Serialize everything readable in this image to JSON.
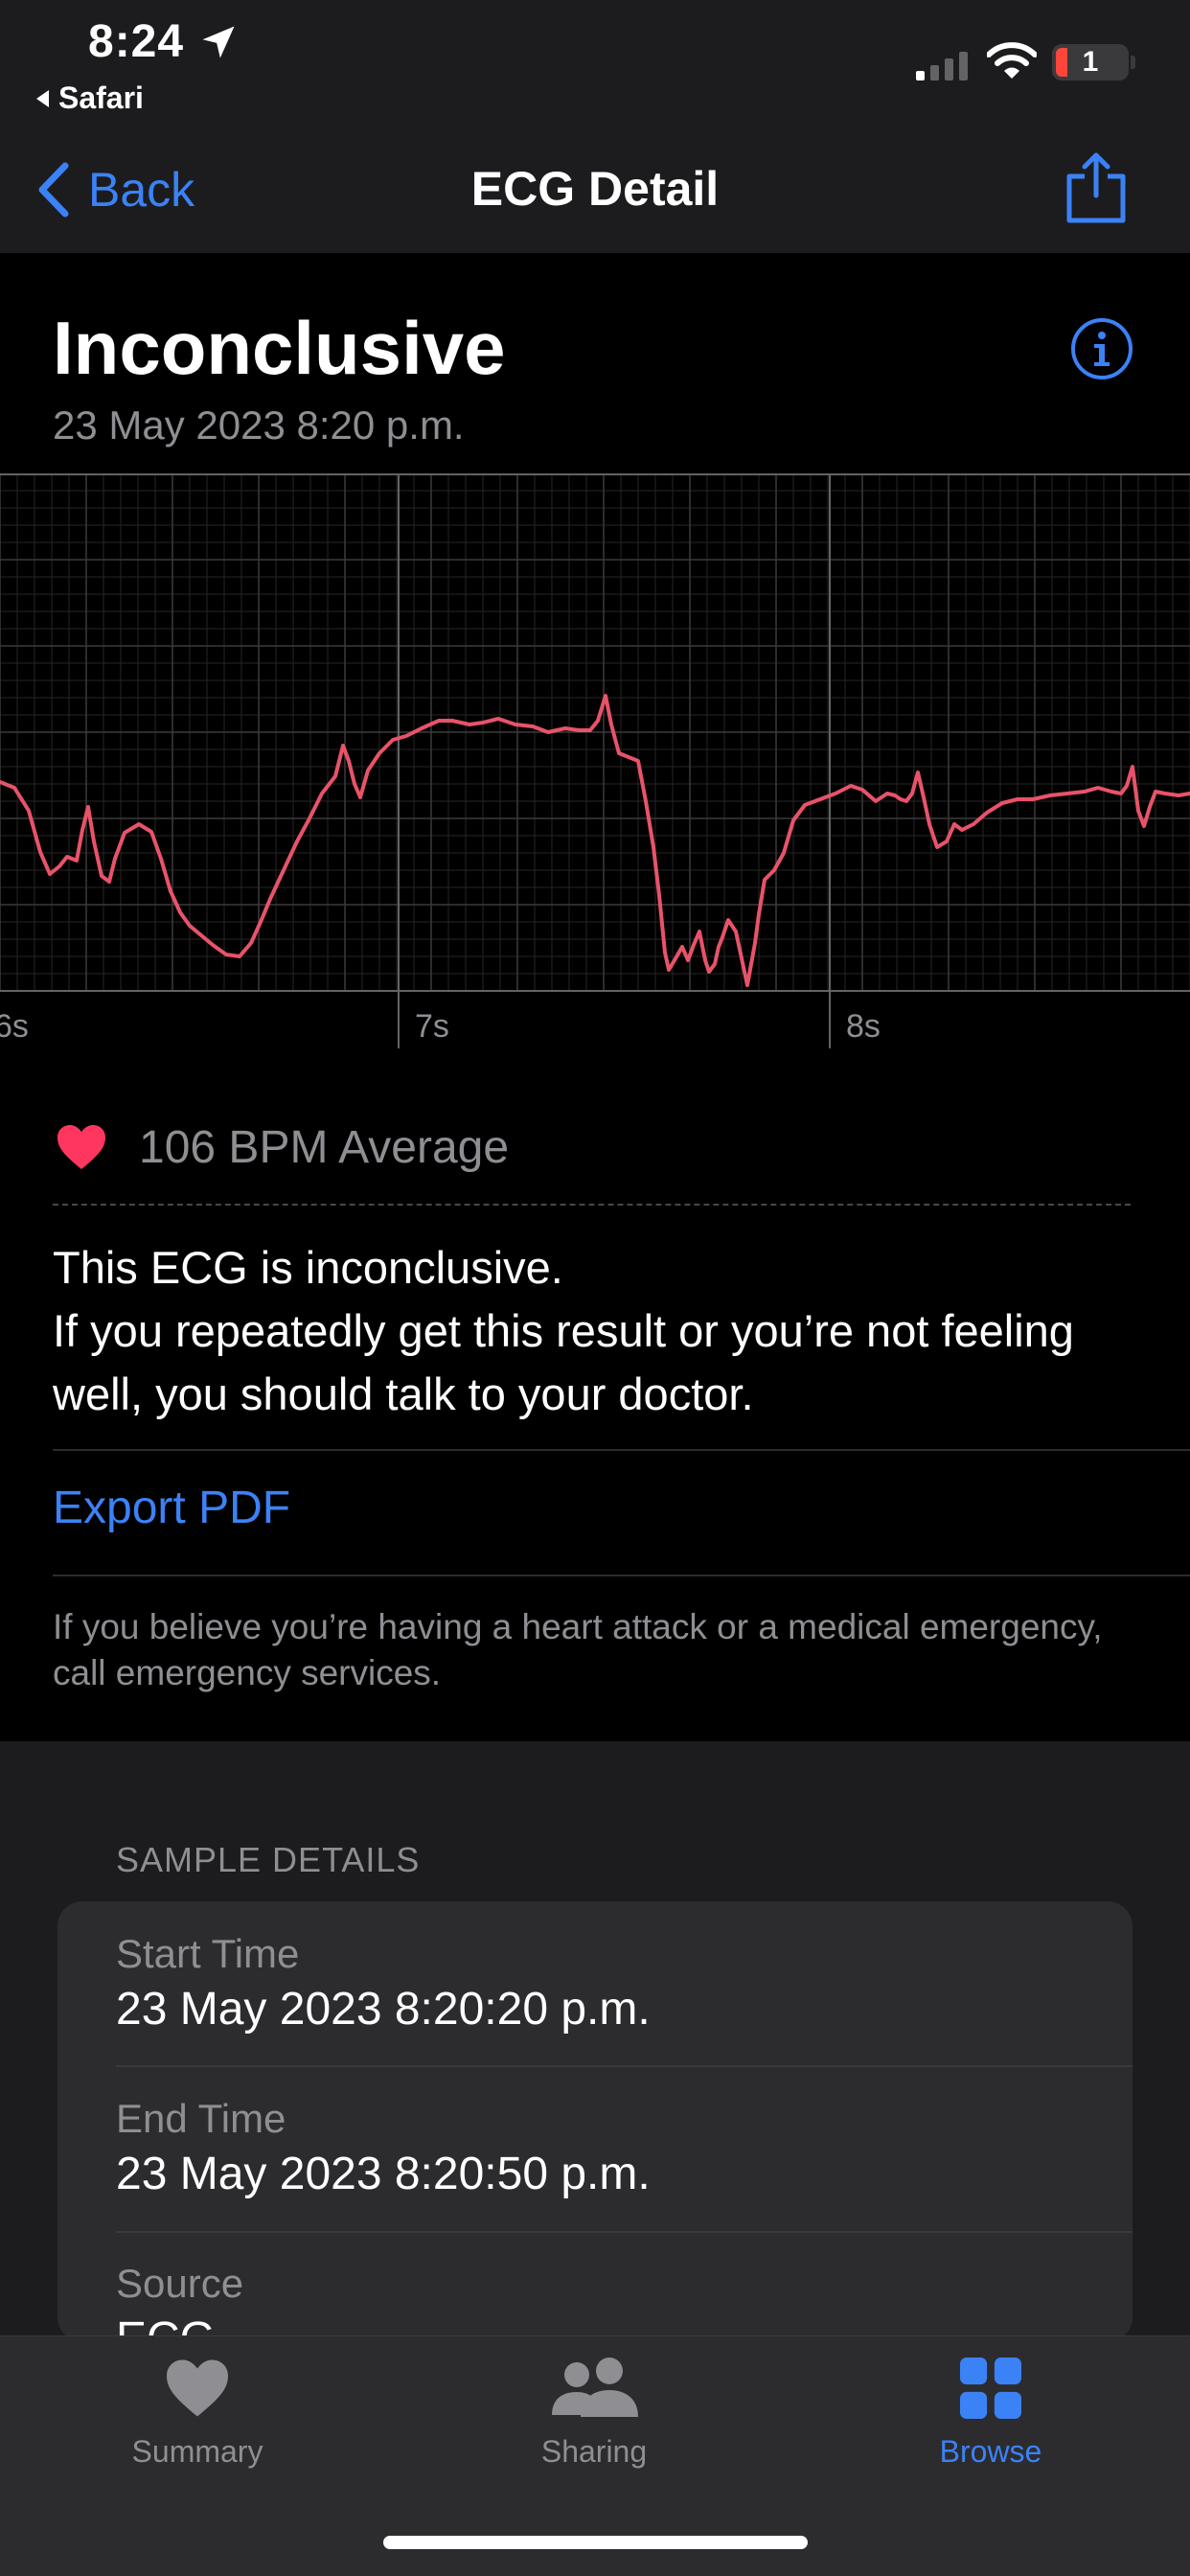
{
  "status_bar": {
    "time": "8:24",
    "back_app": "Safari",
    "battery": "1"
  },
  "nav": {
    "back_label": "Back",
    "title": "ECG Detail"
  },
  "header": {
    "title": "Inconclusive",
    "date": "23 May 2023 8:20 p.m."
  },
  "ecg": {
    "time_labels": [
      "6s",
      "7s",
      "8s"
    ],
    "trace_color": "#e8536a"
  },
  "heart_rate": {
    "text": "106 BPM Average"
  },
  "message": {
    "line1": "This ECG is inconclusive.",
    "line2": "If you repeatedly get this result or you’re not feeling well, you should talk to your doctor."
  },
  "actions": {
    "export_label": "Export PDF"
  },
  "emergency_note": "If you believe you’re having a heart attack or a medical emergency, call emergency services.",
  "sample_details": {
    "heading": "SAMPLE DETAILS",
    "rows": [
      {
        "label": "Start Time",
        "value": "23 May 2023 8:20:20 p.m."
      },
      {
        "label": "End Time",
        "value": "23 May 2023 8:20:50 p.m."
      },
      {
        "label": "Source",
        "value": "ECG"
      }
    ]
  },
  "tabs": [
    {
      "label": "Summary",
      "icon": "heart-icon",
      "active": false
    },
    {
      "label": "Sharing",
      "icon": "people-icon",
      "active": false
    },
    {
      "label": "Browse",
      "icon": "grid-icon",
      "active": true
    }
  ],
  "colors": {
    "accent": "#3b82f6",
    "heart": "#ff375f"
  }
}
